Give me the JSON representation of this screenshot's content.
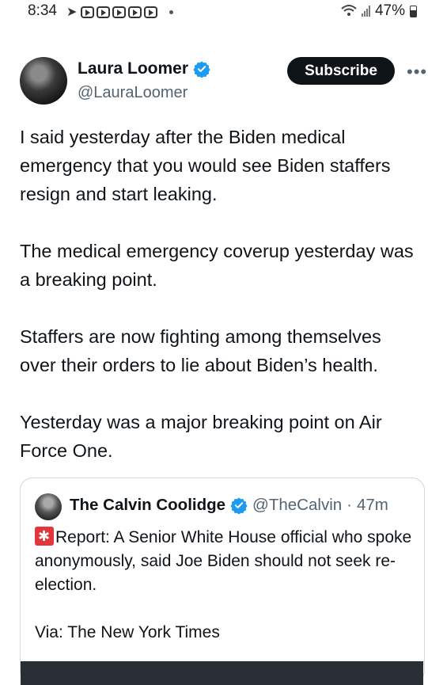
{
  "status_bar": {
    "time": "8:34",
    "battery": "47%"
  },
  "tweet": {
    "author_name": "Laura Loomer",
    "author_handle": "@LauraLoomer",
    "subscribe_label": "Subscribe",
    "more_label": "•••",
    "paragraphs": [
      "I said yesterday after the Biden medical emergency that you would see Biden staffers resign and start leaking.",
      "The medical emergency coverup yesterday was a breaking point.",
      "Staffers are now fighting among themselves over their orders to lie about Biden’s health.",
      "Yesterday was a major breaking point on Air Force One."
    ]
  },
  "quote": {
    "author_name": "The Calvin Coolidge",
    "author_handle": "@TheCalvin",
    "separator": "·",
    "time": "47m",
    "text_1": "Report: A Senior White House official who spoke anonymously, said Joe Biden should not seek re-election.",
    "text_2": "Via: The New York Times"
  },
  "colors": {
    "verified_blue": "#1d9bf0",
    "siren_red": "#e2363b",
    "text_primary": "#0f1419",
    "text_secondary": "#536471"
  },
  "icons": [
    "send-icon",
    "youtube-icon",
    "wifi-icon",
    "signal-icon",
    "battery-icon",
    "verified-icon",
    "more-icon",
    "siren-icon"
  ]
}
